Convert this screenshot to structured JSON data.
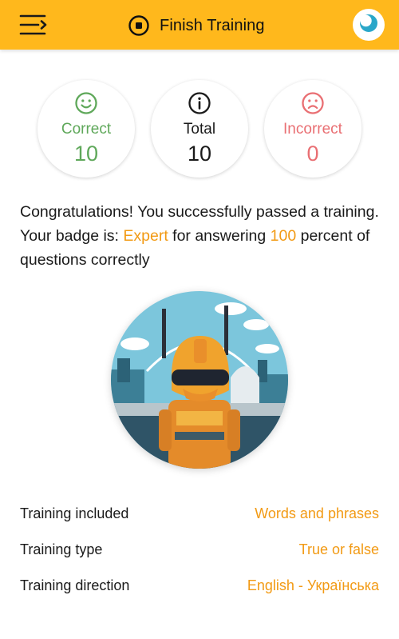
{
  "header": {
    "title": "Finish Training",
    "menu_icon": "menu-collapse-icon",
    "title_icon": "stop-circle-icon",
    "theme_icon": "moon-icon",
    "background_color": "#ffb81c"
  },
  "stats": {
    "correct": {
      "label": "Correct",
      "value": "10",
      "icon": "smile-icon",
      "color": "#5fa85a"
    },
    "total": {
      "label": "Total",
      "value": "10",
      "icon": "info-icon",
      "color": "#1a1a1a"
    },
    "incorrect": {
      "label": "Incorrect",
      "value": "0",
      "icon": "sad-icon",
      "color": "#e96f73"
    }
  },
  "message": {
    "part1": "Congratulations! You successfully passed a training. Your badge is: ",
    "badge_name": "Expert",
    "part2": " for answering ",
    "percent": "100",
    "part3": " percent of questions correctly"
  },
  "badge_image": {
    "icon": "robot-expert-badge-image"
  },
  "details": [
    {
      "label": "Training included",
      "value": "Words and phrases"
    },
    {
      "label": "Training type",
      "value": "True or false"
    },
    {
      "label": "Training direction",
      "value": "English - Українська"
    }
  ],
  "accent_color": "#f29a14"
}
